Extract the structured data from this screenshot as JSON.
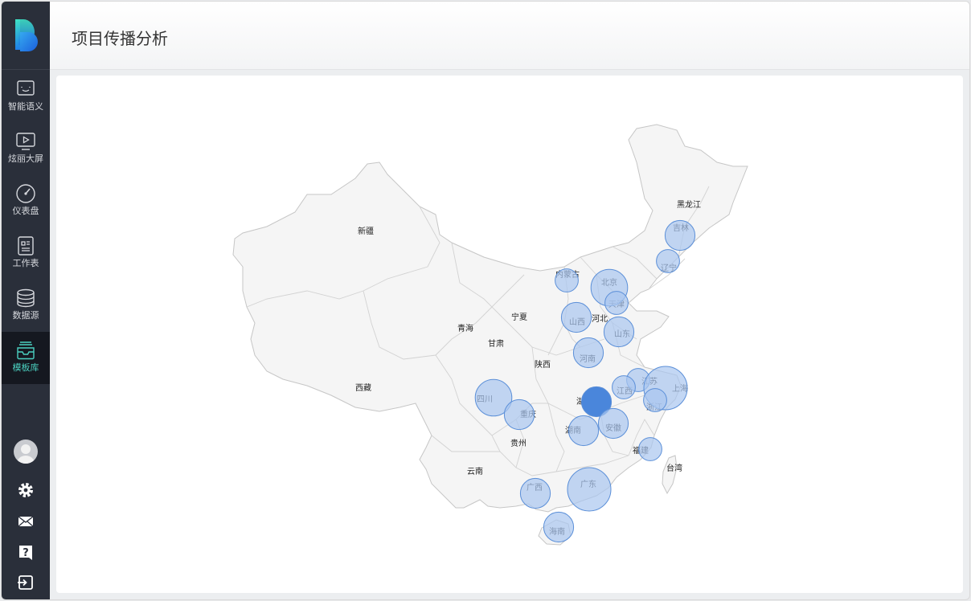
{
  "header": {
    "title": "项目传播分析"
  },
  "sidebar": {
    "items": [
      {
        "label": "智能语义",
        "icon": "smile-chat-icon",
        "active": false
      },
      {
        "label": "炫丽大屏",
        "icon": "play-screen-icon",
        "active": false
      },
      {
        "label": "仪表盘",
        "icon": "gauge-icon",
        "active": false
      },
      {
        "label": "工作表",
        "icon": "worksheet-icon",
        "active": false
      },
      {
        "label": "数据源",
        "icon": "database-icon",
        "active": false
      },
      {
        "label": "模板库",
        "icon": "template-tray-icon",
        "active": true
      }
    ],
    "bottom_icons": [
      "avatar",
      "settings-icon",
      "mail-icon",
      "help-icon",
      "logout-icon"
    ]
  },
  "colors": {
    "sidebar_bg": "#2a2f3a",
    "active_bg": "#151820",
    "active_text": "#4bd0c0",
    "bubble_fill": "#a9c6f0",
    "bubble_stroke": "#5b8fd8",
    "bubble_highlight": "#4a86db",
    "map_fill": "#f5f5f5",
    "map_stroke": "#c8c8c8"
  },
  "map": {
    "labels": {
      "xinjiang": "新疆",
      "xizang": "西藏",
      "qinghai": "青海",
      "gansu": "甘肃",
      "ningxia": "宁夏",
      "neimenggu": "内蒙古",
      "heilongjiang": "黑龙江",
      "jilin": "吉林",
      "liaoning": "辽宁",
      "beijing": "北京",
      "tianjin": "天津",
      "hebei": "河北",
      "shanxi": "山西",
      "shandong": "山东",
      "henan": "河南",
      "shaanxi": "陕西",
      "sichuan": "四川",
      "chongqing": "重庆",
      "hubei": "湖",
      "anhui": "安徽",
      "jiangsu": "江苏",
      "shanghai": "上海",
      "zhejiang": "浙江",
      "jiangxi": "江西",
      "hunan": "湖南",
      "guizhou": "贵州",
      "yunnan": "云南",
      "guangxi": "广西",
      "guangdong": "广东",
      "fujian": "福建",
      "taiwan": "台湾",
      "hainan": "海南"
    },
    "bubbles": [
      {
        "province": "吉林",
        "size": 3
      },
      {
        "province": "辽宁",
        "size": 2
      },
      {
        "province": "内蒙古",
        "size": 2
      },
      {
        "province": "北京",
        "size": 4
      },
      {
        "province": "天津",
        "size": 2
      },
      {
        "province": "山西",
        "size": 3
      },
      {
        "province": "山东",
        "size": 3
      },
      {
        "province": "河南",
        "size": 3
      },
      {
        "province": "四川",
        "size": 4
      },
      {
        "province": "重庆",
        "size": 3
      },
      {
        "province": "湖北",
        "size": 3,
        "highlight": true
      },
      {
        "province": "安徽",
        "size": 3
      },
      {
        "province": "江苏",
        "size": 2
      },
      {
        "province": "江西",
        "size": 2
      },
      {
        "province": "上海",
        "size": 5
      },
      {
        "province": "浙江",
        "size": 2
      },
      {
        "province": "湖南",
        "size": 3
      },
      {
        "province": "福建",
        "size": 2
      },
      {
        "province": "广西",
        "size": 3
      },
      {
        "province": "广东",
        "size": 5
      },
      {
        "province": "海南",
        "size": 3
      }
    ]
  }
}
